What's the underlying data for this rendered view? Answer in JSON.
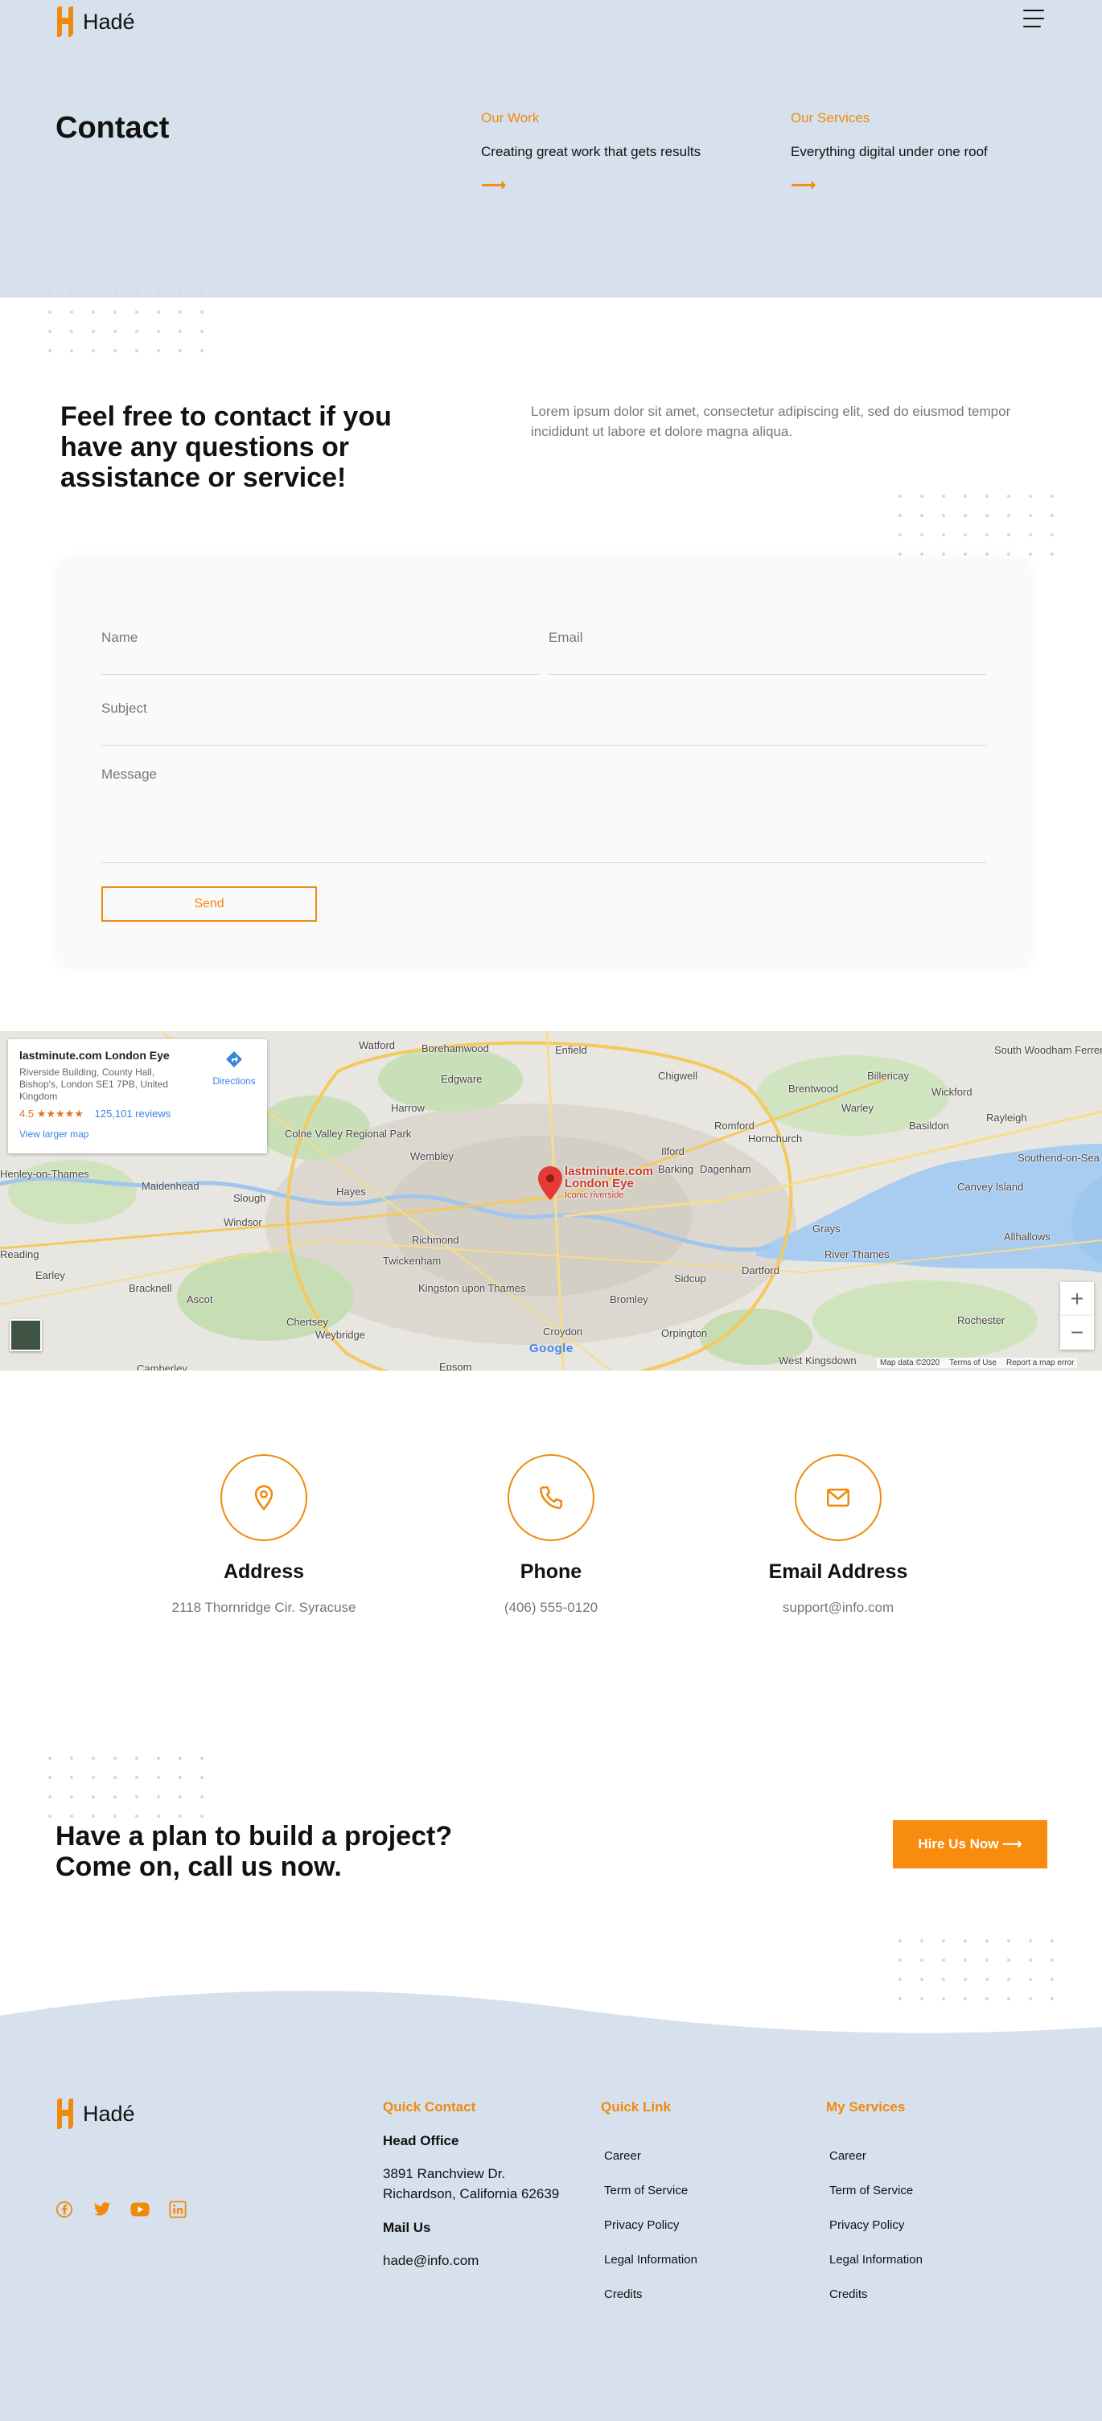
{
  "brand": {
    "name": "Hadé",
    "accent": "#f08a0c",
    "hero_bg": "#d6e1ed"
  },
  "header": {
    "menu_icon": "hamburger-icon"
  },
  "hero": {
    "title": "Contact",
    "columns": [
      {
        "eyebrow": "Our Work",
        "desc": "Creating great work that gets results",
        "arrow": "⟶"
      },
      {
        "eyebrow": "Our Services",
        "desc": "Everything digital under one roof",
        "arrow": "⟶"
      }
    ]
  },
  "intro": {
    "heading": "Feel free to contact if you have any questions or assistance or service!",
    "text": "Lorem ipsum dolor sit amet, consectetur adipiscing elit, sed do eiusmod tempor incididunt ut labore et dolore magna aliqua."
  },
  "form": {
    "name_placeholder": "Name",
    "email_placeholder": "Email",
    "subject_placeholder": "Subject",
    "message_placeholder": "Message",
    "send_label": "Send"
  },
  "map": {
    "card_title": "lastminute.com London Eye",
    "card_address": "Riverside Building, County Hall, Bishop's, London SE1 7PB, United Kingdom",
    "rating": "4.5",
    "stars": "★★★★★",
    "reviews": "125,101 reviews",
    "directions": "Directions",
    "larger_map": "View larger map",
    "pin_title_1": "lastminute.com",
    "pin_title_2": "London Eye",
    "pin_sub": "Iconic riverside",
    "zoom_in": "+",
    "zoom_out": "−",
    "google": "Google",
    "attrib_data": "Map data ©2020",
    "attrib_terms": "Terms of Use",
    "attrib_report": "Report a map error",
    "places": [
      {
        "label": "Watford"
      },
      {
        "label": "Borehamwood"
      },
      {
        "label": "Enfield"
      },
      {
        "label": "Harrow"
      },
      {
        "label": "Edgware"
      },
      {
        "label": "Chigwell"
      },
      {
        "label": "Brentwood"
      },
      {
        "label": "Billericay"
      },
      {
        "label": "Wickford"
      },
      {
        "label": "Romford"
      },
      {
        "label": "Basildon"
      },
      {
        "label": "Wembley"
      },
      {
        "label": "Ilford"
      },
      {
        "label": "Barking"
      },
      {
        "label": "Dagenham"
      },
      {
        "label": "Hornchurch"
      },
      {
        "label": "Colne Valley Regional Park"
      },
      {
        "label": "Maidenhead"
      },
      {
        "label": "Slough"
      },
      {
        "label": "Hayes"
      },
      {
        "label": "Windsor"
      },
      {
        "label": "Richmond"
      },
      {
        "label": "Twickenham"
      },
      {
        "label": "Kingston upon Thames"
      },
      {
        "label": "Bromley"
      },
      {
        "label": "Dartford"
      },
      {
        "label": "Grays"
      },
      {
        "label": "Canvey Island"
      },
      {
        "label": "Southend-on-Sea"
      },
      {
        "label": "Rayleigh"
      },
      {
        "label": "Rochester"
      },
      {
        "label": "Croydon"
      },
      {
        "label": "Sidcup"
      },
      {
        "label": "Orpington"
      },
      {
        "label": "Bracknell"
      },
      {
        "label": "Ascot"
      },
      {
        "label": "Chertsey"
      },
      {
        "label": "Weybridge"
      },
      {
        "label": "Epsom"
      },
      {
        "label": "Earley"
      },
      {
        "label": "Reading"
      },
      {
        "label": "Henley-on-Thames"
      },
      {
        "label": "Allhallows"
      },
      {
        "label": "River Thames"
      },
      {
        "label": "South Woodham Ferrers"
      },
      {
        "label": "Warley"
      },
      {
        "label": "West Kingsdown"
      },
      {
        "label": "Camberley"
      }
    ]
  },
  "info": [
    {
      "label": "Address",
      "value": "2118 Thornridge Cir. Syracuse",
      "icon": "location-pin-icon"
    },
    {
      "label": "Phone",
      "value": "(406) 555-0120",
      "icon": "phone-icon"
    },
    {
      "label": "Email Address",
      "value": "support@info.com",
      "icon": "mail-icon"
    }
  ],
  "cta": {
    "heading": "Have a plan to build a project? Come on, call us now.",
    "button": "Hire Us Now ⟶"
  },
  "footer": {
    "quick_contact": {
      "heading": "Quick Contact",
      "office_label": "Head Office",
      "office_line1": "3891 Ranchview Dr.",
      "office_line2": "Richardson, California 62639",
      "mail_label": "Mail Us",
      "mail": "hade@info.com"
    },
    "quick_link": {
      "heading": "Quick Link",
      "items": [
        "Career",
        "Term of Service",
        "Privacy Policy",
        "Legal Information",
        "Credits"
      ]
    },
    "services": {
      "heading": "My Services",
      "items": [
        "Career",
        "Term of Service",
        "Privacy Policy",
        "Legal Information",
        "Credits"
      ]
    },
    "social": [
      "facebook-icon",
      "twitter-icon",
      "youtube-icon",
      "linkedin-icon"
    ]
  }
}
